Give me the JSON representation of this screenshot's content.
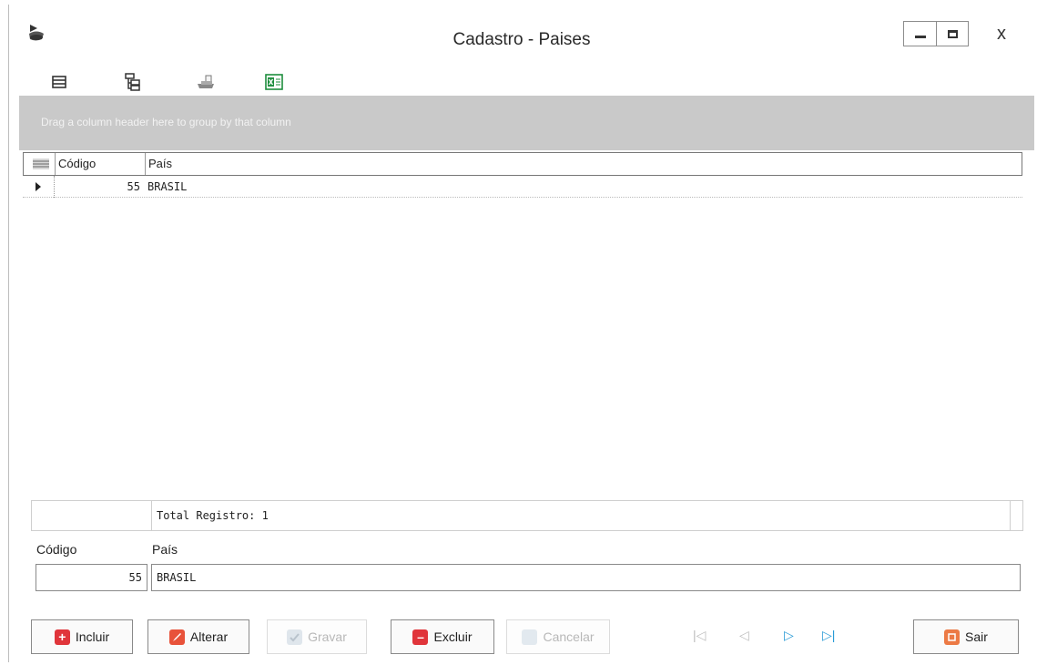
{
  "window": {
    "title": "Cadastro - Paises",
    "close_glyph": "x"
  },
  "group_panel": {
    "text": "Drag a column header here to group by that column"
  },
  "grid": {
    "columns": [
      "Código",
      "País"
    ],
    "rows": [
      {
        "codigo": "55",
        "pais": "BRASIL"
      }
    ],
    "footer": "Total Registro: 1"
  },
  "form": {
    "codigo_label": "Código",
    "codigo_value": "55",
    "pais_label": "País",
    "pais_value": "BRASIL"
  },
  "buttons": {
    "incluir": "Incluir",
    "alterar": "Alterar",
    "gravar": "Gravar",
    "excluir": "Excluir",
    "cancelar": "Cancelar",
    "sair": "Sair"
  },
  "icons": {
    "toolbar": [
      "columns-icon",
      "tree-icon",
      "print-icon",
      "excel-icon"
    ],
    "navigator": [
      "first-record-icon",
      "prior-record-icon",
      "next-record-icon",
      "last-record-icon"
    ]
  },
  "colors": {
    "group_panel": "#c9c9c9",
    "incluir": "#e0353b",
    "alterar": "#e8523a",
    "excluir": "#e0353b",
    "nav_active": "#2a9bd6",
    "excel": "#1e8e3e"
  }
}
